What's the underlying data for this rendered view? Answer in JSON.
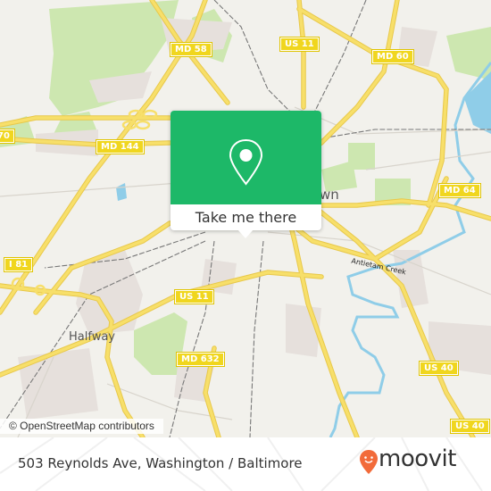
{
  "map": {
    "road_shields": [
      {
        "id": "md58",
        "label": "MD 58"
      },
      {
        "id": "us11-north",
        "label": "US 11"
      },
      {
        "id": "md60",
        "label": "MD 60"
      },
      {
        "id": "md144",
        "label": "MD 144"
      },
      {
        "id": "i70",
        "label": "70"
      },
      {
        "id": "md64",
        "label": "MD 64"
      },
      {
        "id": "i81",
        "label": "I 81"
      },
      {
        "id": "us11-south",
        "label": "US 11"
      },
      {
        "id": "md632",
        "label": "MD 632"
      },
      {
        "id": "us40-east",
        "label": "US 40"
      },
      {
        "id": "us40-southeast",
        "label": "US 40"
      }
    ],
    "place_labels": {
      "halfway": "Halfway",
      "town_partial": "wn"
    },
    "water_labels": {
      "antietam": "Antietam Creek"
    },
    "colors": {
      "land": "#f2f1ec",
      "park": "#cde7b0",
      "residential": "#e6e0dc",
      "road": "#f7df6a",
      "road_casing": "#e8c84a",
      "water": "#8fcde8",
      "rail": "#777777",
      "shield": "#f0d61e"
    }
  },
  "attribution": "© OpenStreetMap contributors",
  "popup": {
    "icon": "map-pin-icon",
    "button_label": "Take me there",
    "accent_color": "#1db868"
  },
  "footer": {
    "address": "503 Reynolds Ave, Washington / Baltimore",
    "brand": "moovit",
    "brand_color": "#f26b3a"
  }
}
